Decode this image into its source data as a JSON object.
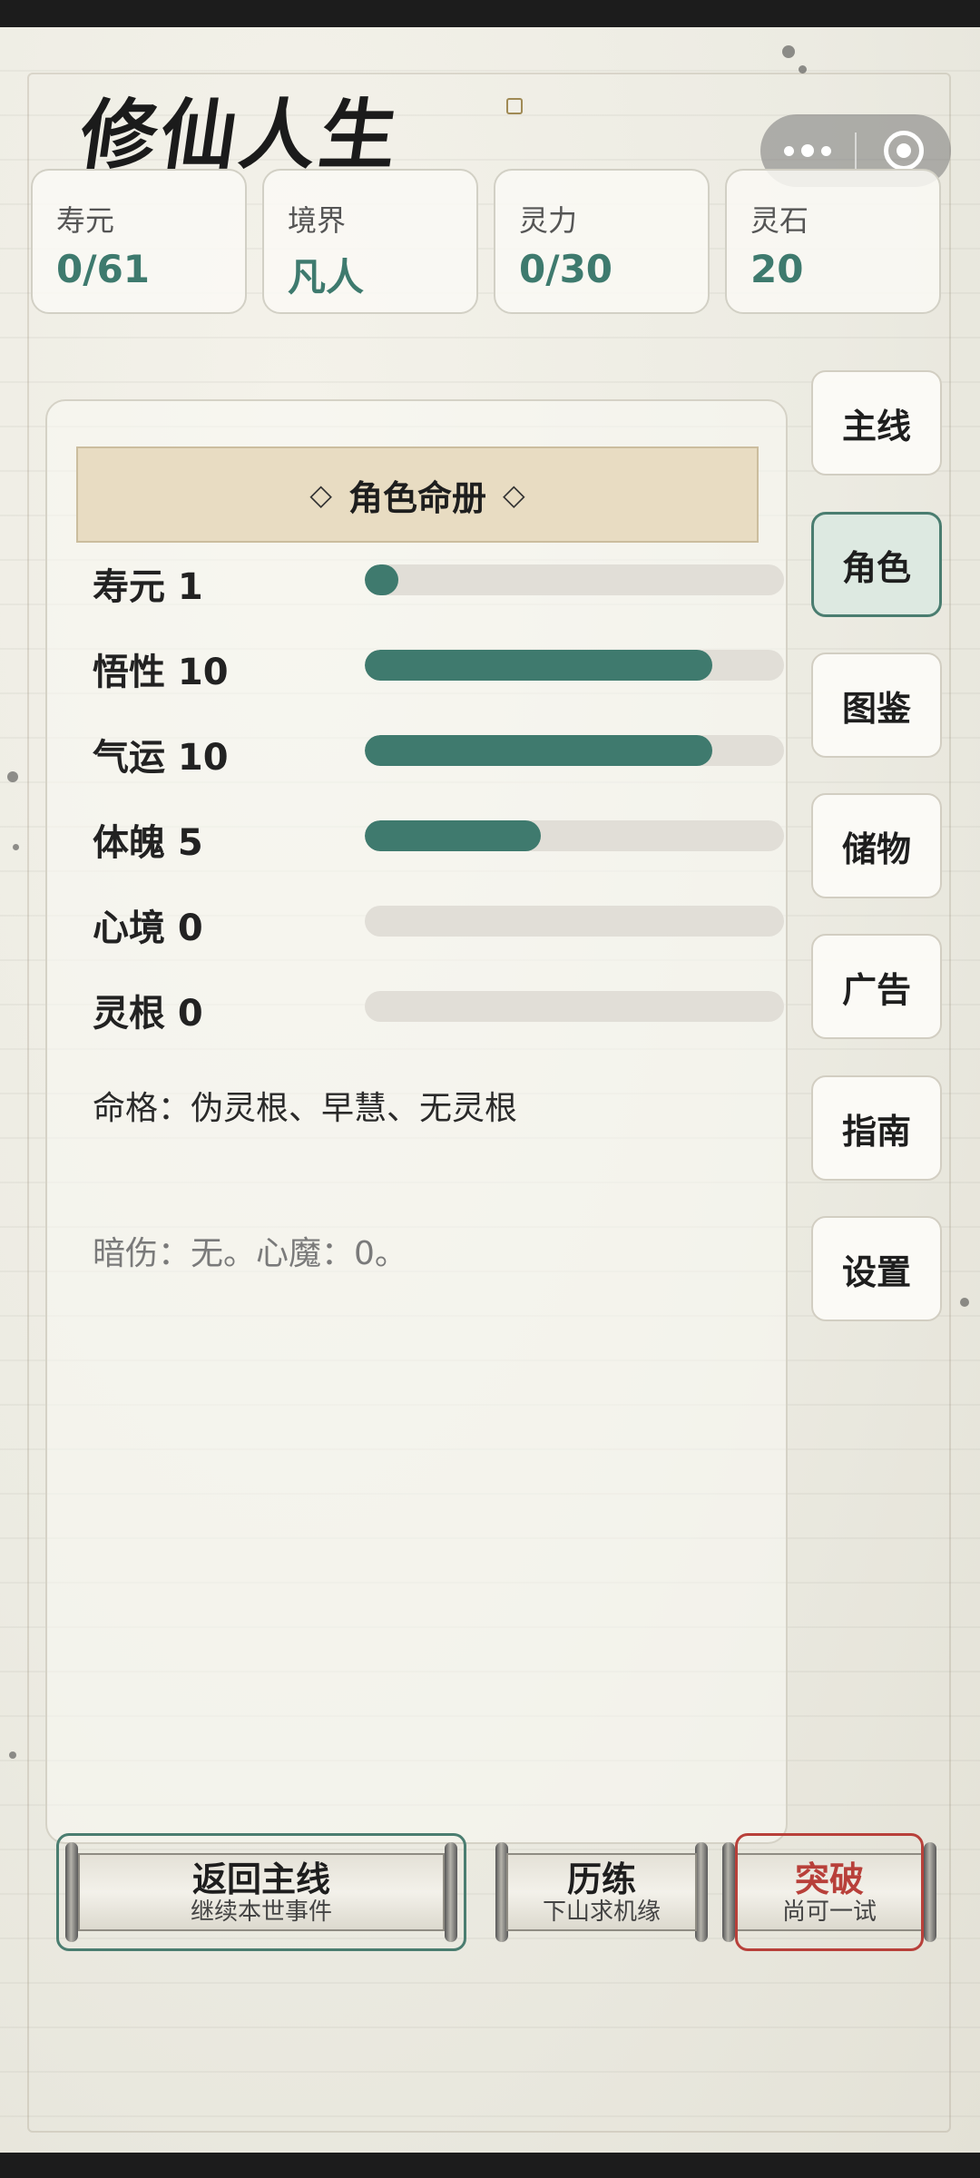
{
  "app": {
    "title": "修仙人生"
  },
  "capsule": {
    "more_icon": "more-dots-icon",
    "close_icon": "close-circle-icon"
  },
  "stats": [
    {
      "label": "寿元",
      "value": "0/61"
    },
    {
      "label": "境界",
      "value": "凡人"
    },
    {
      "label": "灵力",
      "value": "0/30"
    },
    {
      "label": "灵石",
      "value": "20"
    }
  ],
  "panel": {
    "title": "角色命册",
    "title_left": "◇",
    "title_right": "◇",
    "attributes": [
      {
        "label": "寿元 1",
        "fill": 0.08
      },
      {
        "label": "悟性 10",
        "fill": 0.83
      },
      {
        "label": "气运 10",
        "fill": 0.83
      },
      {
        "label": "体魄 5",
        "fill": 0.42
      },
      {
        "label": "心境 0",
        "fill": 0.0
      },
      {
        "label": "灵根 0",
        "fill": 0.0
      }
    ],
    "fate": "命格：伪灵根、早慧、无灵根",
    "injury": "暗伤：无。心魔：0。"
  },
  "nav": [
    {
      "label": "主线",
      "active": false
    },
    {
      "label": "角色",
      "active": true
    },
    {
      "label": "图鉴",
      "active": false
    },
    {
      "label": "储物",
      "active": false
    },
    {
      "label": "广告",
      "active": false
    },
    {
      "label": "指南",
      "active": false
    },
    {
      "label": "设置",
      "active": false
    }
  ],
  "actions": {
    "return": {
      "title": "返回主线",
      "sub": "继续本世事件"
    },
    "train": {
      "title": "历练",
      "sub": "下山求机缘"
    },
    "breakthrough": {
      "title": "突破",
      "sub": "尚可一试"
    }
  },
  "colors": {
    "accent": "#3f7a6e",
    "bar_track": "#e1ded7",
    "header_bg": "#e8dcc2",
    "danger": "#b8403a",
    "nav_active_bg": "#dde9e1"
  }
}
